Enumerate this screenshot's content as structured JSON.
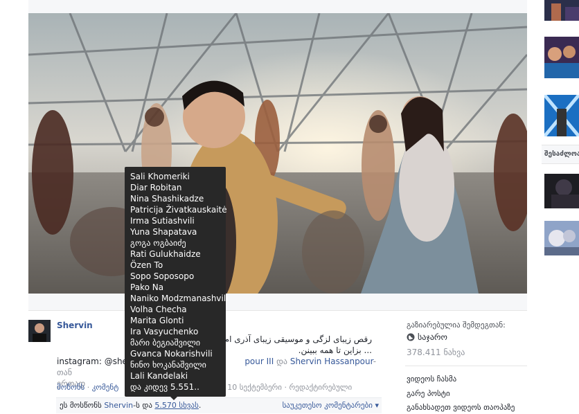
{
  "video": {
    "status": "playing"
  },
  "sidebar": {
    "suggested_label": "შესაძლოა"
  },
  "post": {
    "author": "Shervin",
    "description_line1": "رقص زیبای لزگی و موسیقی زیبای آذری ام ... و لذت ببرین .لطفا به",
    "description_line2": "... بزاین تا همه ببینن.",
    "instagram_prefix": "instagram: @shervi",
    "tagged_tail_link1": "pour III",
    "tagged_and": "და",
    "tagged_tail_link2": "Shervin Hassanpour",
    "tagged_suffix": "-თან",
    "tagged_line2": "ერთად",
    "actions": {
      "like": "მოწონს",
      "comment": "კომენტ",
      "date_text": "10 სექტემბერი",
      "edited": "რედაქტირებული",
      "separator": "·"
    },
    "likes": {
      "prefix": "ეს მოსწონს",
      "name": "Shervin",
      "middle": "-ს და",
      "others_link": "5.570 სხვას",
      "end": "."
    },
    "sort_comments": "საუკეთესო კომენტარები ▾"
  },
  "info": {
    "shared_with_label": "გაზიარებულია შემდეგთან:",
    "privacy": "საჯარო",
    "views": "378.411 ნახვა",
    "action_embed": "ვიდეოს ჩასმა",
    "action_post": "გარე პოსტი",
    "action_theater": "განახსადეთ ვიდეოს თაოპაზე"
  },
  "tooltip": {
    "likers": [
      "Sali Khomeriki",
      "Diar Robitan",
      "Nina Shashikadze",
      "Patricija Živatkauskaitė",
      "Irma Sutiashvili",
      "Yuna Shapatava",
      "გოგა ოგბაიძე",
      "Rati Gulukhaidze",
      "Özen To",
      "Sopo Soposopo",
      "Pako Na",
      "Naniko Modzmanashvili",
      "Volha Checha",
      "Marita Glonti",
      "Ira Vasyuchenko",
      "მარი ბეგიაშვილი",
      "Gvanca Nokarishvili",
      "ნინო ხოკანაშვილი",
      "Lali Kandelaki",
      "და კიდევ 5.551.."
    ]
  },
  "colors": {
    "link": "#365899",
    "tooltip_bg": "#282828",
    "muted": "#90949c"
  }
}
